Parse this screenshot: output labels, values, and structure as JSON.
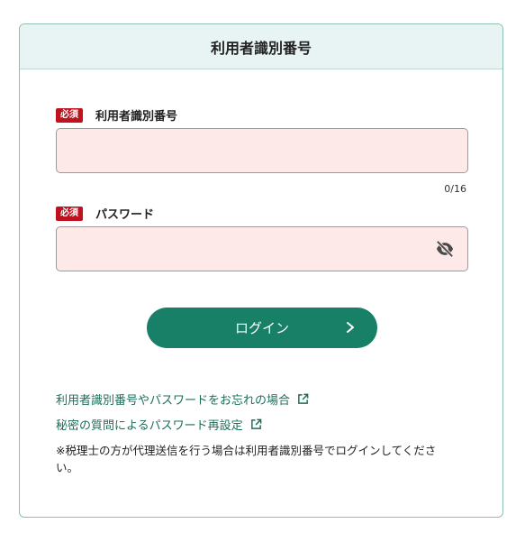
{
  "header": {
    "title": "利用者識別番号"
  },
  "fields": {
    "user_id": {
      "required_badge": "必須",
      "label": "利用者識別番号",
      "value": "",
      "counter": "0/16"
    },
    "password": {
      "required_badge": "必須",
      "label": "パスワード",
      "value": "",
      "visibility_icon": "eye-off-icon"
    }
  },
  "login_button": {
    "label": "ログイン",
    "icon": "chevron-right-icon"
  },
  "links": [
    {
      "label": "利用者識別番号やパスワードをお忘れの場合",
      "icon": "external-link-icon"
    },
    {
      "label": "秘密の質問によるパスワード再設定",
      "icon": "external-link-icon"
    }
  ],
  "note": "※税理士の方が代理送信を行う場合は利用者識別番号でログインしてください。",
  "colors": {
    "header_bg": "#e8f4f3",
    "badge": "#c0121e",
    "input_bg": "#fce9e8",
    "button": "#178066",
    "link": "#1b6e5a"
  }
}
